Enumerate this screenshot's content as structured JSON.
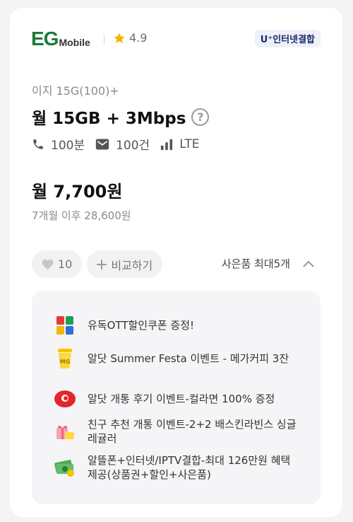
{
  "header": {
    "logo_main": "EG",
    "logo_sub": "Mobile",
    "rating": "4.9",
    "badge": "U⁺인터넷결합"
  },
  "plan": {
    "name": "이지 15G(100)+",
    "title": "월 15GB + 3Mbps",
    "help": "?",
    "specs": [
      {
        "icon": "phone-icon",
        "label": "100분"
      },
      {
        "icon": "message-icon",
        "label": "100건"
      },
      {
        "icon": "signal-icon",
        "label": "LTE"
      }
    ],
    "price": "월 7,700원",
    "price_after": "7개월 이후 28,600원"
  },
  "actions": {
    "likes": "10",
    "compare": "비교하기",
    "gifts_toggle": "사은품 최대5개"
  },
  "gifts": [
    {
      "icon": "yudok-ott-icon",
      "text": "유독OTT할인쿠폰 증정!"
    },
    {
      "icon": "coffee-cup-icon",
      "text": "알닷 Summer Festa 이벤트 - 메가커피 3잔"
    },
    {
      "icon": "red-circle-icon",
      "text": "알닷 개통 후기 이벤트-컬라면 100% 증정"
    },
    {
      "icon": "gift-box-icon",
      "text": "친구 추천 개통 이벤트-2+2 배스킨라빈스 싱글레귤러"
    },
    {
      "icon": "money-icon",
      "text": "알뜰폰+인터넷/IPTV결합-최대 126만원 혜택 제공(상품권+할인+사은품)"
    }
  ],
  "colors": {
    "brand_green": "#1f7a3a",
    "star": "#f5b400",
    "badge_text": "#1b2a6b"
  }
}
